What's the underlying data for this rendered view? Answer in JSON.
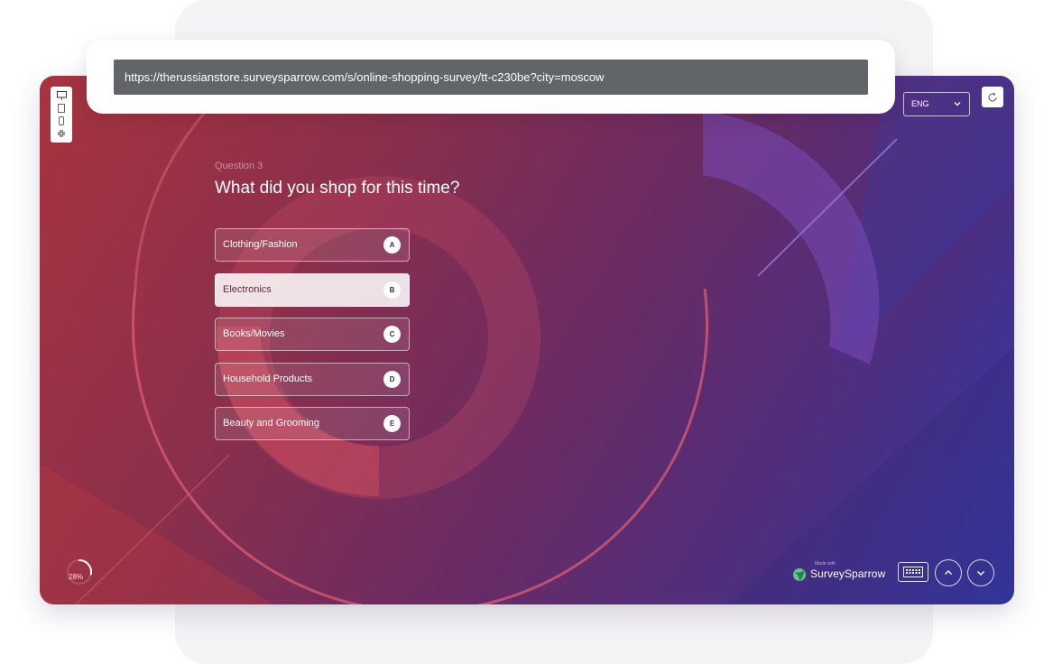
{
  "browser": {
    "url": "https://therussianstore.surveysparrow.com/s/online-shopping-survey/tt-c230be?city=moscow"
  },
  "toolbar": {
    "devices": [
      "desktop-icon",
      "tablet-icon",
      "mobile-icon",
      "collapse-icon"
    ]
  },
  "language": {
    "selected": "ENG"
  },
  "question": {
    "number_label": "Question 3",
    "title": "What did you shop for this time?",
    "options": [
      {
        "label": "Clothing/Fashion",
        "key": "A",
        "selected": false
      },
      {
        "label": "Electronics",
        "key": "B",
        "selected": true
      },
      {
        "label": "Books/Movies",
        "key": "C",
        "selected": false
      },
      {
        "label": "Household Products",
        "key": "D",
        "selected": false
      },
      {
        "label": "Beauty and Grooming",
        "key": "E",
        "selected": false
      }
    ]
  },
  "progress": {
    "value": 0.28,
    "label": "28%"
  },
  "branding": {
    "made_with": "Made with",
    "name": "SurveySparrow"
  },
  "colors": {
    "gradient_start": "#a8333f",
    "gradient_end": "#2f3aa8",
    "url_bar": "#616469",
    "brand_green": "#5fc48a"
  }
}
